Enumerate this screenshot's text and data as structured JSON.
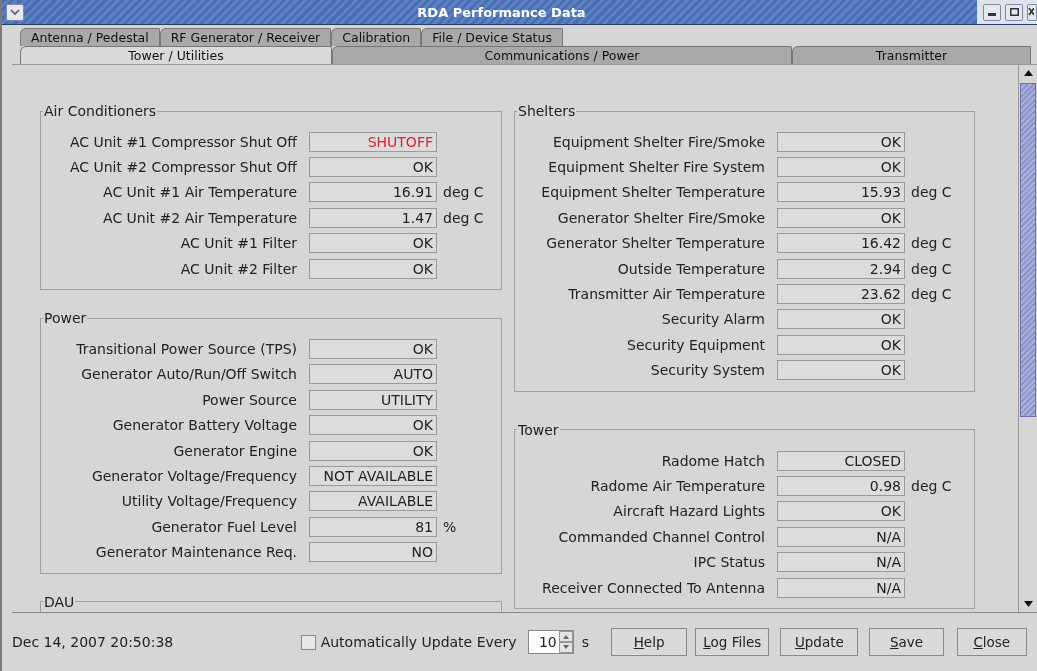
{
  "window": {
    "title": "RDA Performance Data"
  },
  "tabs_row_1": [
    {
      "label": "Antenna / Pedestal",
      "selected": false
    },
    {
      "label": "RF Generator / Receiver",
      "selected": false
    },
    {
      "label": "Calibration",
      "selected": false
    },
    {
      "label": "File / Device Status",
      "selected": false
    }
  ],
  "tabs_row_2": [
    {
      "label": "Tower / Utilities",
      "selected": true
    },
    {
      "label": "Communications / Power",
      "selected": false
    },
    {
      "label": "Transmitter",
      "selected": false
    }
  ],
  "left_column": [
    {
      "title": "Air Conditioners",
      "rows": [
        {
          "label": "AC Unit #1 Compressor Shut Off",
          "value": "SHUTOFF",
          "alarm": true
        },
        {
          "label": "AC Unit #2 Compressor Shut Off",
          "value": "OK",
          "alarm": false
        },
        {
          "label": "AC Unit #1 Air Temperature",
          "value": "16.91",
          "unit": "deg C",
          "alarm": false
        },
        {
          "label": "AC Unit #2 Air Temperature",
          "value": "1.47",
          "unit": "deg C",
          "alarm": false
        },
        {
          "label": "AC Unit #1 Filter",
          "value": "OK",
          "alarm": false
        },
        {
          "label": "AC Unit #2 Filter",
          "value": "OK",
          "alarm": false
        }
      ]
    },
    {
      "title": "Power",
      "rows": [
        {
          "label": "Transitional Power Source (TPS)",
          "value": "OK",
          "alarm": false
        },
        {
          "label": "Generator Auto/Run/Off Switch",
          "value": "AUTO",
          "alarm": false
        },
        {
          "label": "Power Source",
          "value": "UTILITY",
          "alarm": false
        },
        {
          "label": "Generator Battery Voltage",
          "value": "OK",
          "alarm": false
        },
        {
          "label": "Generator Engine",
          "value": "OK",
          "alarm": false
        },
        {
          "label": "Generator Voltage/Frequency",
          "value": "NOT AVAILABLE",
          "alarm": false
        },
        {
          "label": "Utility Voltage/Frequency",
          "value": "AVAILABLE",
          "alarm": false
        },
        {
          "label": "Generator Fuel Level",
          "value": "81",
          "unit": "%",
          "alarm": false
        },
        {
          "label": "Generator Maintenance Req.",
          "value": "NO",
          "alarm": false
        }
      ]
    },
    {
      "title": "DAU"
    }
  ],
  "right_column": [
    {
      "title": "Shelters",
      "rows": [
        {
          "label": "Equipment Shelter Fire/Smoke",
          "value": "OK",
          "alarm": false
        },
        {
          "label": "Equipment Shelter Fire System",
          "value": "OK",
          "alarm": false
        },
        {
          "label": "Equipment Shelter Temperature",
          "value": "15.93",
          "unit": "deg C",
          "alarm": false
        },
        {
          "label": "Generator Shelter Fire/Smoke",
          "value": "OK",
          "alarm": false
        },
        {
          "label": "Generator Shelter Temperature",
          "value": "16.42",
          "unit": "deg C",
          "alarm": false
        },
        {
          "label": "Outside Temperature",
          "value": "2.94",
          "unit": "deg C",
          "alarm": false
        },
        {
          "label": "Transmitter Air Temperature",
          "value": "23.62",
          "unit": "deg C",
          "alarm": false
        },
        {
          "label": "Security Alarm",
          "value": "OK",
          "alarm": false
        },
        {
          "label": "Security Equipment",
          "value": "OK",
          "alarm": false
        },
        {
          "label": "Security System",
          "value": "OK",
          "alarm": false
        }
      ]
    },
    {
      "title": "Tower",
      "rows": [
        {
          "label": "Radome Hatch",
          "value": "CLOSED",
          "alarm": false
        },
        {
          "label": "Radome Air Temperature",
          "value": "0.98",
          "unit": "deg C",
          "alarm": false
        },
        {
          "label": "Aircraft Hazard Lights",
          "value": "OK",
          "alarm": false
        },
        {
          "label": "Commanded Channel Control",
          "value": "N/A",
          "alarm": false
        },
        {
          "label": "IPC Status",
          "value": "N/A",
          "alarm": false
        },
        {
          "label": "Receiver Connected To Antenna",
          "value": "N/A",
          "alarm": false
        }
      ]
    }
  ],
  "status_bar": {
    "timestamp": "Dec 14, 2007 20:50:38",
    "auto_update": {
      "label": "Automatically Update Every",
      "checked": false
    },
    "interval": {
      "value": "10",
      "unit": "s"
    },
    "buttons": [
      {
        "label": "Help"
      },
      {
        "label": "Log Files"
      },
      {
        "label": "Update"
      },
      {
        "label": "Save"
      },
      {
        "label": "Close"
      }
    ]
  }
}
